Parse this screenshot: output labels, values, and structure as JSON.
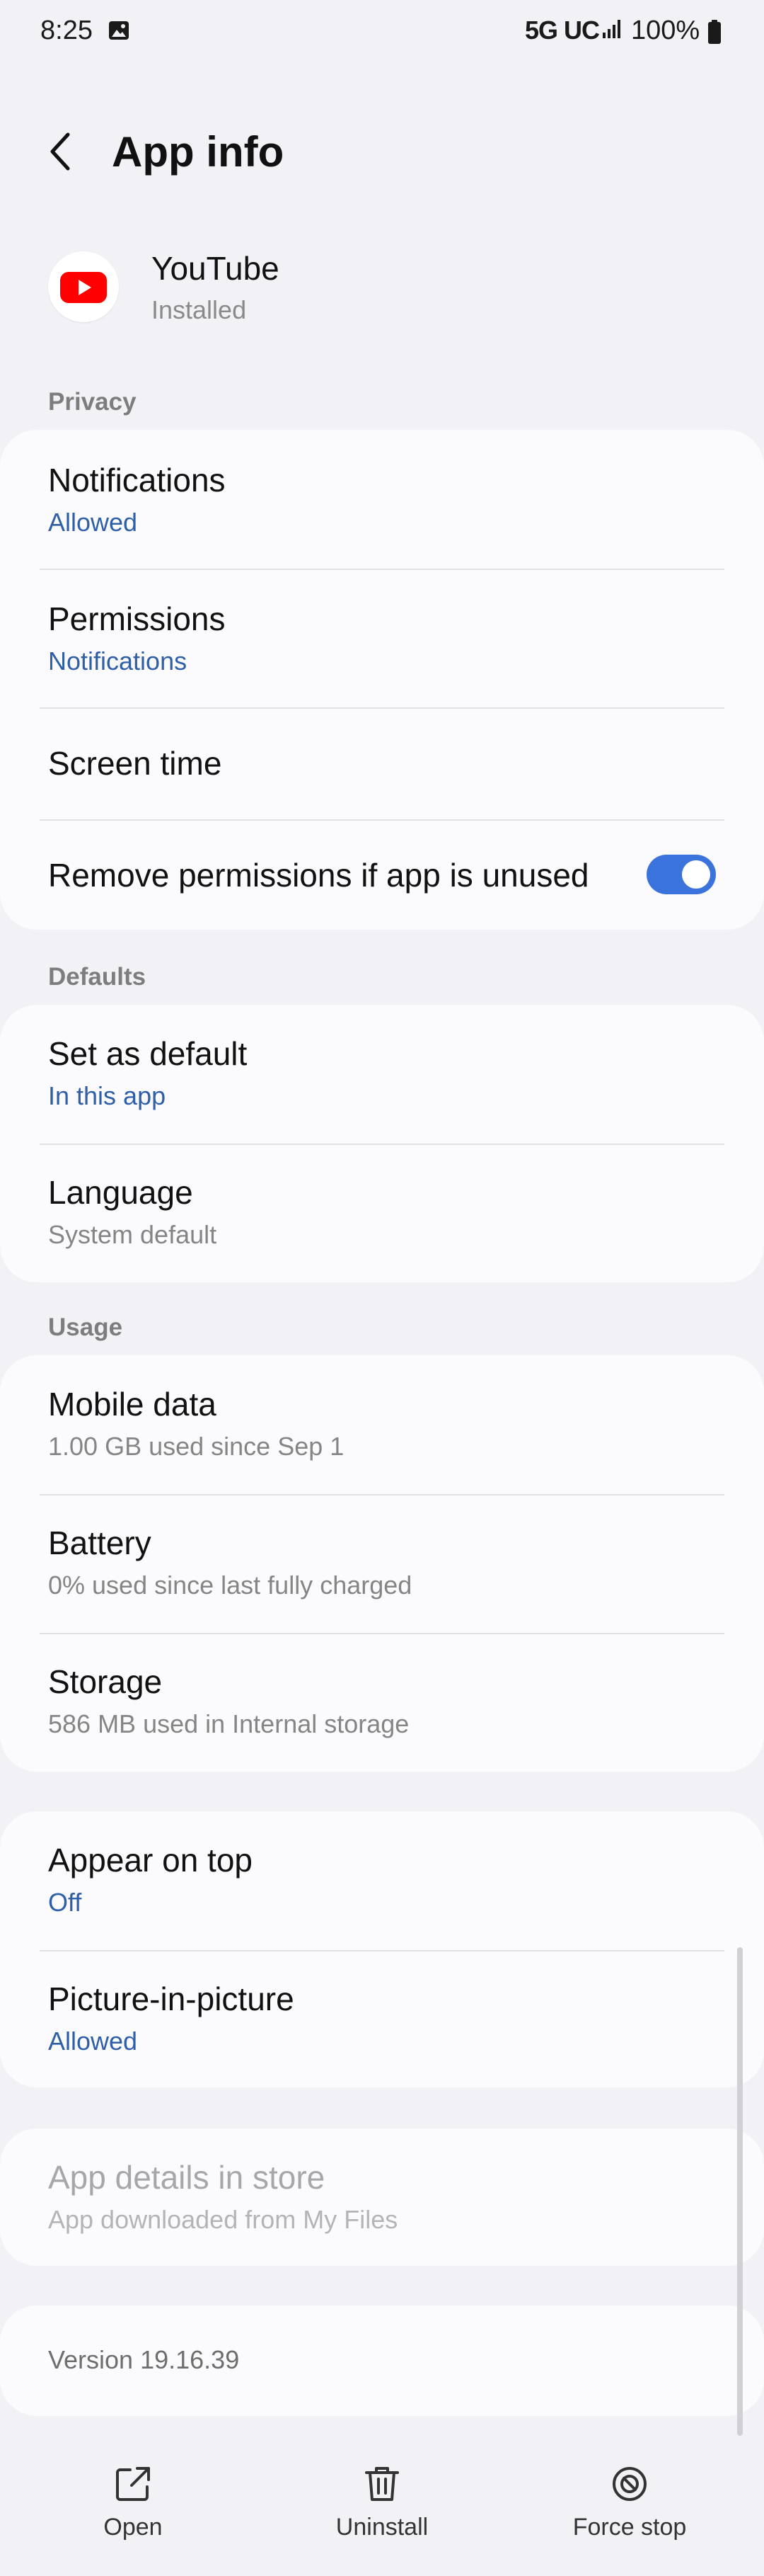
{
  "status_bar": {
    "time": "8:25",
    "network": "5G UC",
    "battery": "100%"
  },
  "header": {
    "title": "App info"
  },
  "app": {
    "name": "YouTube",
    "status": "Installed"
  },
  "sections": {
    "privacy": {
      "label": "Privacy",
      "notifications": {
        "title": "Notifications",
        "value": "Allowed"
      },
      "permissions": {
        "title": "Permissions",
        "value": "Notifications"
      },
      "screen_time": {
        "title": "Screen time"
      },
      "remove_permissions": {
        "title": "Remove permissions if app is unused",
        "enabled": true
      }
    },
    "defaults": {
      "label": "Defaults",
      "set_as_default": {
        "title": "Set as default",
        "value": "In this app"
      },
      "language": {
        "title": "Language",
        "value": "System default"
      }
    },
    "usage": {
      "label": "Usage",
      "mobile_data": {
        "title": "Mobile data",
        "value": "1.00 GB used since Sep 1"
      },
      "battery": {
        "title": "Battery",
        "value": "0% used since last fully charged"
      },
      "storage": {
        "title": "Storage",
        "value": "586 MB used in Internal storage"
      }
    },
    "advanced": {
      "appear_on_top": {
        "title": "Appear on top",
        "value": "Off"
      },
      "picture_in_picture": {
        "title": "Picture-in-picture",
        "value": "Allowed"
      }
    },
    "store": {
      "app_details": {
        "title": "App details in store",
        "value": "App downloaded from My Files"
      }
    },
    "version": {
      "text": "Version 19.16.39"
    }
  },
  "bottom_bar": {
    "open": "Open",
    "uninstall": "Uninstall",
    "force_stop": "Force stop"
  },
  "colors": {
    "accent": "#3a73dc",
    "link_text": "#2f5fa8",
    "youtube_red": "#ff0000"
  }
}
